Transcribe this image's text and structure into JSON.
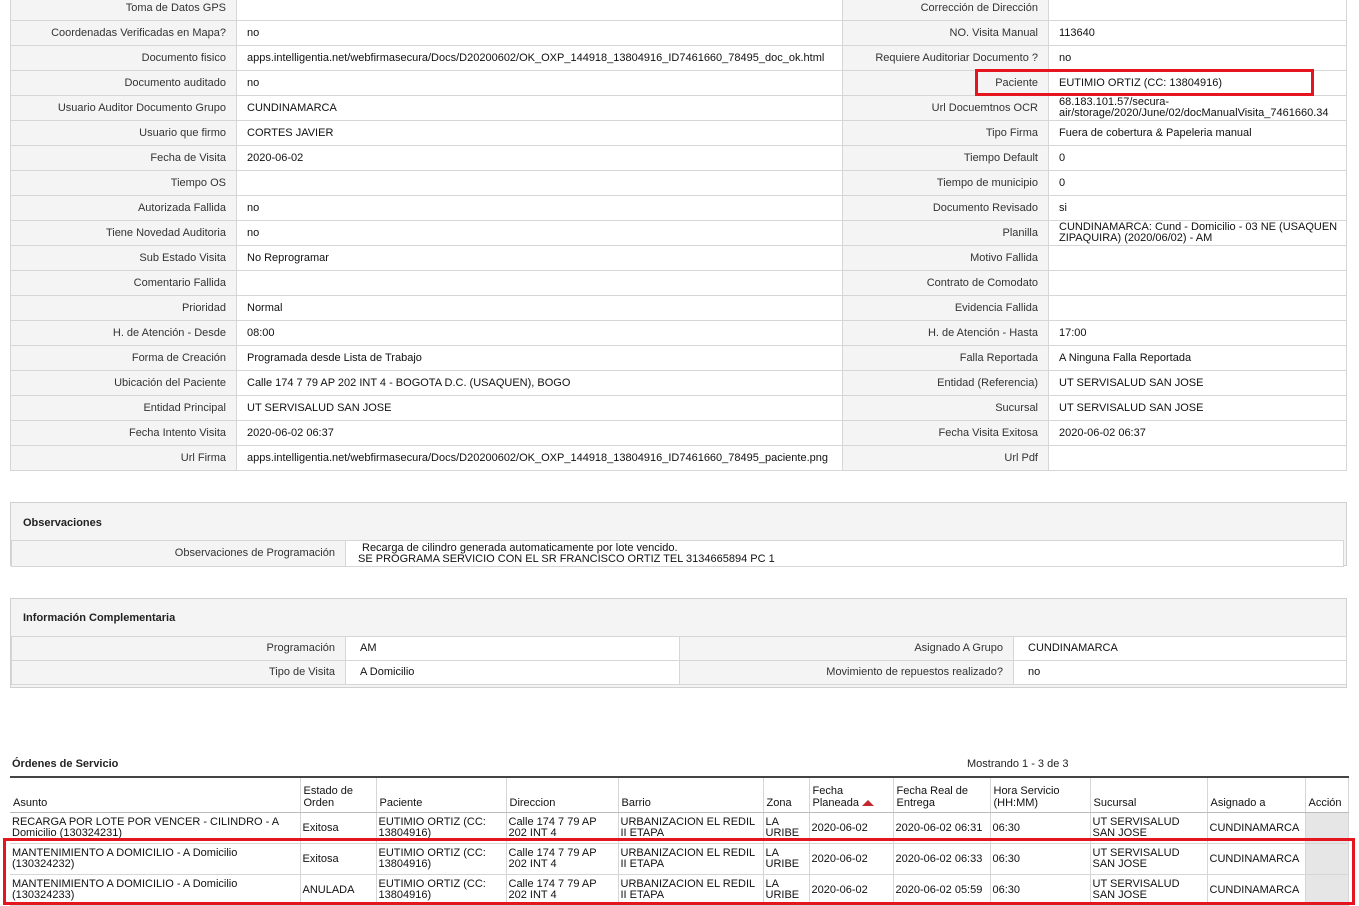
{
  "details": {
    "rows": [
      {
        "l1": "Toma de Datos GPS",
        "v1": "",
        "l2": "Corrección de Dirección",
        "v2": ""
      },
      {
        "l1": "Coordenadas Verificadas en Mapa?",
        "v1": "no",
        "l2": "NO. Visita Manual",
        "v2": "113640"
      },
      {
        "l1": "Documento fisico",
        "v1": "apps.intelligentia.net/webfirmasecura/Docs/D20200602/OK_OXP_144918_13804916_ID7461660_78495_doc_ok.html",
        "l2": "Requiere Auditoriar Documento ?",
        "v2": "no"
      },
      {
        "l1": "Documento auditado",
        "v1": "no",
        "l2": "Paciente",
        "v2": "EUTIMIO ORTIZ (CC: 13804916)"
      },
      {
        "l1": "Usuario Auditor Documento Grupo",
        "v1": "CUNDINAMARCA",
        "l2": "Url Docuemtnos OCR",
        "v2": "68.183.101.57/secura-air/storage/2020/June/02/docManualVisita_7461660.34"
      },
      {
        "l1": "Usuario que firmo",
        "v1": "CORTES JAVIER",
        "l2": "Tipo Firma",
        "v2": "Fuera de cobertura & Papeleria manual"
      },
      {
        "l1": "Fecha de Visita",
        "v1": "2020-06-02",
        "l2": "Tiempo Default",
        "v2": "0"
      },
      {
        "l1": "Tiempo OS",
        "v1": "",
        "l2": "Tiempo de municipio",
        "v2": "0"
      },
      {
        "l1": "Autorizada Fallida",
        "v1": "no",
        "l2": "Documento Revisado",
        "v2": "si"
      },
      {
        "l1": "Tiene Novedad Auditoria",
        "v1": "no",
        "l2": "Planilla",
        "v2": "CUNDINAMARCA: Cund - Domicilio - 03 NE (USAQUEN ZIPAQUIRA) (2020/06/02) - AM"
      },
      {
        "l1": "Sub Estado Visita",
        "v1": "No Reprogramar",
        "l2": "Motivo Fallida",
        "v2": ""
      },
      {
        "l1": "Comentario Fallida",
        "v1": "",
        "l2": "Contrato de Comodato",
        "v2": ""
      },
      {
        "l1": "Prioridad",
        "v1": "Normal",
        "l2": "Evidencia Fallida",
        "v2": ""
      },
      {
        "l1": "H. de Atención - Desde",
        "v1": "08:00",
        "l2": "H. de Atención - Hasta",
        "v2": "17:00"
      },
      {
        "l1": "Forma de Creación",
        "v1": "Programada desde Lista de Trabajo",
        "l2": "Falla Reportada",
        "v2": "A Ninguna Falla Reportada"
      },
      {
        "l1": "Ubicación del Paciente",
        "v1": "Calle 174 7 79 AP 202 INT 4 - BOGOTA D.C. (USAQUEN), BOGO",
        "l2": "Entidad (Referencia)",
        "v2": "UT SERVISALUD SAN JOSE"
      },
      {
        "l1": "Entidad Principal",
        "v1": "UT SERVISALUD SAN JOSE",
        "l2": "Sucursal",
        "v2": "UT SERVISALUD SAN JOSE"
      },
      {
        "l1": "Fecha Intento Visita",
        "v1": "2020-06-02 06:37",
        "l2": "Fecha Visita Exitosa",
        "v2": "2020-06-02 06:37"
      },
      {
        "l1": "Url Firma",
        "v1": "apps.intelligentia.net/webfirmasecura/Docs/D20200602/OK_OXP_144918_13804916_ID7461660_78495_paciente.png",
        "l2": "Url Pdf",
        "v2": ""
      }
    ]
  },
  "observaciones": {
    "title": "Observaciones",
    "label": "Observaciones de Programación",
    "line1": "Recarga de cilindro generada automaticamente por lote vencido.",
    "line2": "SE PROGRAMA SERVICIO CON EL SR FRANCISCO ORTIZ TEL 3134665894 PC 1"
  },
  "complementaria": {
    "title": "Información Complementaria",
    "programacion_label": "Programación",
    "programacion_value": "AM",
    "asignado_label": "Asignado A Grupo",
    "asignado_value": "CUNDINAMARCA",
    "tipo_label": "Tipo de Visita",
    "tipo_value": "A Domicilio",
    "movimiento_label": "Movimiento de repuestos realizado?",
    "movimiento_value": "no"
  },
  "ordenes": {
    "title": "Órdenes de Servicio",
    "count": "Mostrando 1 - 3 de 3",
    "headers": {
      "asunto": "Asunto",
      "estado": "Estado de Orden",
      "paciente": "Paciente",
      "direccion": "Direccion",
      "barrio": "Barrio",
      "zona": "Zona",
      "fecha_planeada": "Fecha Planeada",
      "fecha_real": "Fecha Real de Entrega",
      "hora": "Hora Servicio (HH:MM)",
      "sucursal": "Sucursal",
      "asignado": "Asignado a",
      "accion": "Acción"
    },
    "rows": [
      {
        "asunto": "RECARGA POR LOTE POR VENCER - CILINDRO - A Domicilio (130324231)",
        "estado": "Exitosa",
        "paciente": "EUTIMIO ORTIZ (CC: 13804916)",
        "direccion": "Calle 174 7 79 AP 202 INT 4",
        "barrio": "URBANIZACION EL REDIL II ETAPA",
        "zona": "LA URIBE",
        "fecha_planeada": "2020-06-02",
        "fecha_real": "2020-06-02 06:31",
        "hora": "06:30",
        "sucursal": "UT SERVISALUD SAN JOSE",
        "asignado": "CUNDINAMARCA"
      },
      {
        "asunto": "MANTENIMIENTO A DOMICILIO - A Domicilio (130324232)",
        "estado": "Exitosa",
        "paciente": "EUTIMIO ORTIZ (CC: 13804916)",
        "direccion": "Calle 174 7 79 AP 202 INT 4",
        "barrio": "URBANIZACION EL REDIL II ETAPA",
        "zona": "LA URIBE",
        "fecha_planeada": "2020-06-02",
        "fecha_real": "2020-06-02 06:33",
        "hora": "06:30",
        "sucursal": "UT SERVISALUD SAN JOSE",
        "asignado": "CUNDINAMARCA"
      },
      {
        "asunto": "MANTENIMIENTO A DOMICILIO - A Domicilio (130324233)",
        "estado": "ANULADA",
        "paciente": "EUTIMIO ORTIZ (CC: 13804916)",
        "direccion": "Calle 174 7 79 AP 202 INT 4",
        "barrio": "URBANIZACION EL REDIL II ETAPA",
        "zona": "LA URIBE",
        "fecha_planeada": "2020-06-02",
        "fecha_real": "2020-06-02 05:59",
        "hora": "06:30",
        "sucursal": "UT SERVISALUD SAN JOSE",
        "asignado": "CUNDINAMARCA"
      }
    ]
  },
  "colors": {
    "highlight": "#e4151f",
    "label_bg": "#f4f4f4",
    "border": "#d6d6d6",
    "sort_arrow": "#c0282d"
  }
}
